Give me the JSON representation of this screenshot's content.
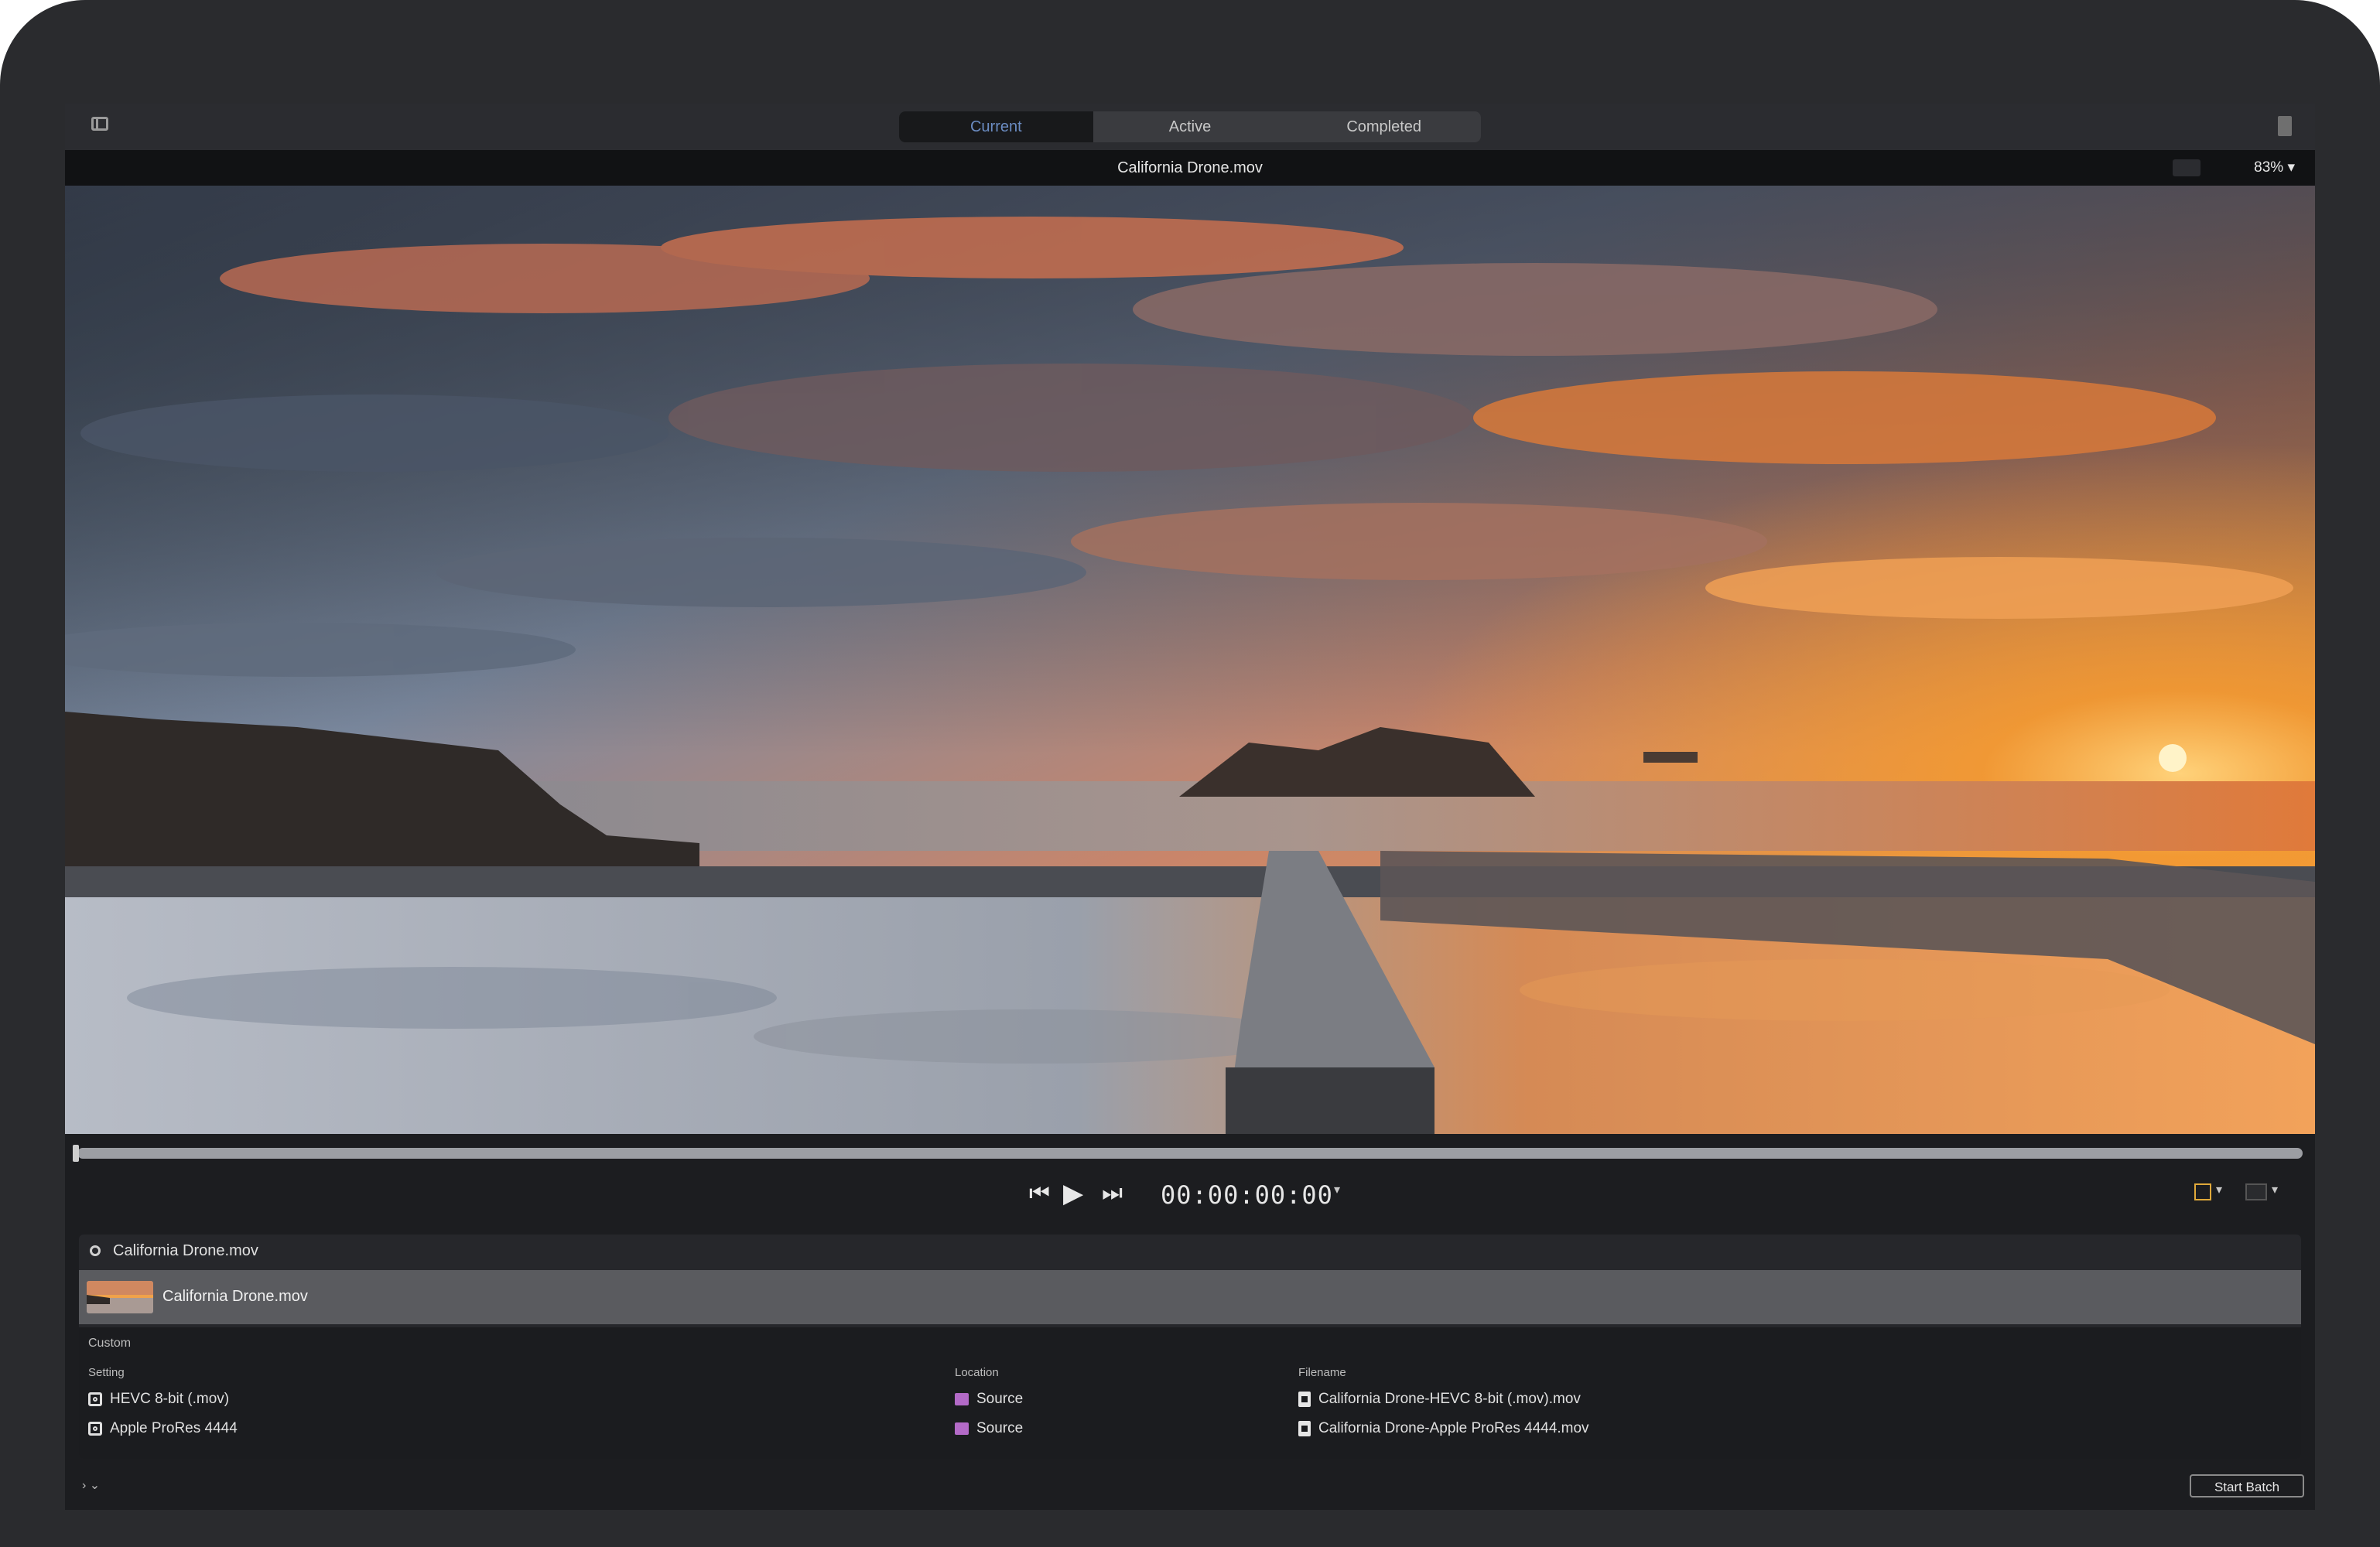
{
  "toolbar": {
    "tabs": [
      {
        "label": "Current",
        "active": true
      },
      {
        "label": "Active",
        "active": false
      },
      {
        "label": "Completed",
        "active": false
      }
    ],
    "icons": {
      "left": "sidebar-icon",
      "right": "inspector-icon"
    }
  },
  "viewer": {
    "title": "California Drone.mov",
    "zoom_label": "83% ▾"
  },
  "transport": {
    "timecode": "00:00:00:00",
    "icons": [
      "skip-back-icon",
      "play-icon",
      "skip-forward-icon"
    ]
  },
  "batch": {
    "name": "California Drone.mov",
    "meta": "",
    "job": {
      "name": "California Drone.mov",
      "group_label": "Custom",
      "columns": {
        "setting": "Setting",
        "location": "Location",
        "filename": "Filename"
      },
      "rows": [
        {
          "setting": "HEVC 8-bit (.mov)",
          "location": "Source",
          "filename": "California Drone-HEVC 8-bit (.mov).mov"
        },
        {
          "setting": "Apple ProRes 4444",
          "location": "Source",
          "filename": "California Drone-Apple ProRes 4444.mov"
        }
      ]
    }
  },
  "footer": {
    "disclose": "› ⌄",
    "start_button": "Start Batch"
  },
  "colors": {
    "accent_blue": "#6b8cc2",
    "location_swatch": "#b36ac7",
    "overlay_accent": "#e0a93a"
  }
}
